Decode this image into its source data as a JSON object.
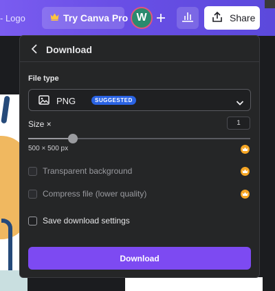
{
  "topbar": {
    "brand_text": "- Logo",
    "pro_label": "Try Canva Pro",
    "avatar_initial": "W",
    "share_label": "Share"
  },
  "dialog": {
    "title": "Download",
    "file_type_label": "File type",
    "file_type_value": "PNG",
    "file_type_badge": "SUGGESTED",
    "size_label": "Size ×",
    "size_value": "1",
    "size_slider_fraction": 0.2,
    "dimensions": "500 × 500 px",
    "options": [
      {
        "label": "Transparent background",
        "checked": false,
        "enabled": false,
        "pro": true
      },
      {
        "label": "Compress file (lower quality)",
        "checked": false,
        "enabled": false,
        "pro": true
      },
      {
        "label": "Save download settings",
        "checked": false,
        "enabled": true,
        "pro": false
      }
    ],
    "download_label": "Download"
  },
  "colors": {
    "accent": "#7d4af2",
    "badge": "#2a63e3",
    "crown": "#f5a524",
    "panel": "#252627"
  },
  "icons": [
    "crown-icon",
    "plus-icon",
    "bar-chart-icon",
    "share-upload-icon",
    "chevron-left-icon",
    "image-icon",
    "chevron-down-icon"
  ]
}
